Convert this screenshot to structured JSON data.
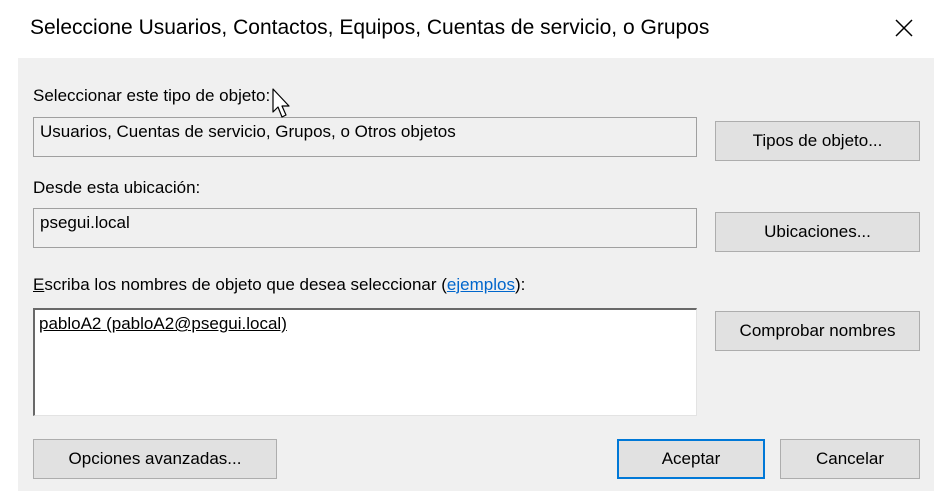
{
  "dialog": {
    "title": "Seleccione Usuarios, Contactos, Equipos, Cuentas de servicio, o Grupos",
    "close_glyph": "✕"
  },
  "object_type": {
    "label": "Seleccionar este tipo de objeto:",
    "value": "Usuarios, Cuentas de servicio, Grupos, o Otros objetos",
    "button_label": "Tipos de objeto..."
  },
  "location": {
    "label": "Desde esta ubicación:",
    "value": "psegui.local",
    "button_label": "Ubicaciones..."
  },
  "names": {
    "label_accel": "E",
    "label_rest": "scriba los nombres de objeto que desea seleccionar (",
    "examples_link": "ejemplos",
    "label_end": "):",
    "entry": "pabloA2 (pabloA2@psegui.local)",
    "check_button_label": "Comprobar nombres"
  },
  "footer": {
    "advanced_label": "Opciones avanzadas...",
    "ok_label": "Aceptar",
    "cancel_label": "Cancelar"
  },
  "colors": {
    "client_background": "#f0f0f0",
    "default_button_border": "#0078d7",
    "link": "#0066cc"
  },
  "icons": {
    "close": "close-icon",
    "cursor": "mouse-pointer-icon"
  }
}
